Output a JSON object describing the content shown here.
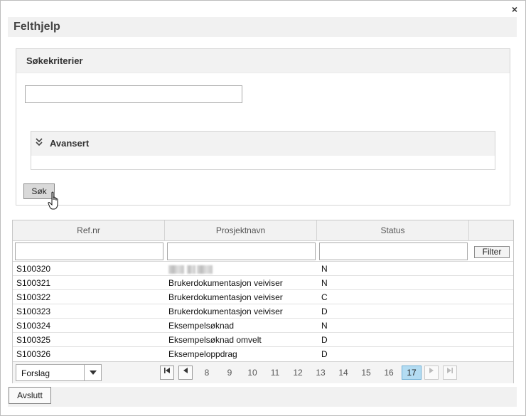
{
  "dialog": {
    "title": "Felthjelp",
    "close_glyph": "×"
  },
  "search": {
    "header": "Søkekriterier",
    "input_value": "",
    "advanced_label": "Avansert",
    "advanced_chevron": "»",
    "search_button": "Søk"
  },
  "grid": {
    "columns": [
      "Ref.nr",
      "Prosjektnavn",
      "Status"
    ],
    "filter_button": "Filter",
    "rows": [
      {
        "ref": "S100320",
        "name": "",
        "status": "N"
      },
      {
        "ref": "S100321",
        "name": "Brukerdokumentasjon veiviser",
        "status": "N"
      },
      {
        "ref": "S100322",
        "name": "Brukerdokumentasjon veiviser",
        "status": "C"
      },
      {
        "ref": "S100323",
        "name": "Brukerdokumentasjon veiviser",
        "status": "D"
      },
      {
        "ref": "S100324",
        "name": "Eksempelsøknad",
        "status": "N"
      },
      {
        "ref": "S100325",
        "name": "Eksempelsøknad omvelt",
        "status": "D"
      },
      {
        "ref": "S100326",
        "name": "Eksempeloppdrag",
        "status": "D"
      }
    ]
  },
  "pager": {
    "select_value": "Forslag",
    "dropdown_glyph": "▼",
    "first_glyph": "⏮",
    "prev_glyph": "◀",
    "next_glyph": "▶",
    "last_glyph": "⏭",
    "pages": [
      "8",
      "9",
      "10",
      "11",
      "12",
      "13",
      "14",
      "15",
      "16",
      "17"
    ],
    "active_page": "17"
  },
  "footer": {
    "close_button": "Avslutt"
  }
}
